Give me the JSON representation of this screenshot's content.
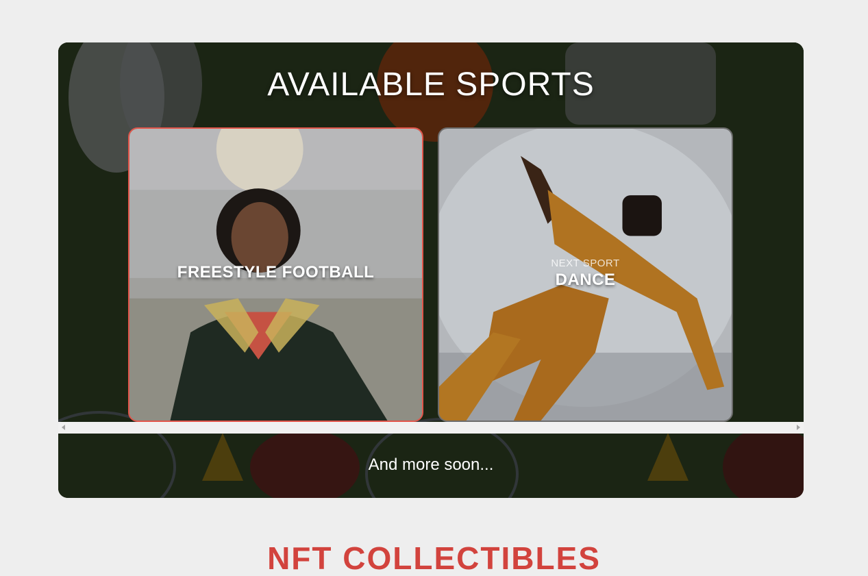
{
  "section": {
    "title": "AVAILABLE SPORTS",
    "footer_text": "And more soon..."
  },
  "cards": [
    {
      "kicker": "",
      "title": "FREESTYLE FOOTBALL",
      "state": "active"
    },
    {
      "kicker": "NEXT SPORT",
      "title": "DANCE",
      "state": "next"
    }
  ],
  "next_section": {
    "title": "NFT COLLECTIBLES"
  },
  "colors": {
    "page_background": "#eeeeee",
    "active_card_border": "#e2554a",
    "next_section_heading": "#d2433d",
    "text": "#ffffff"
  }
}
